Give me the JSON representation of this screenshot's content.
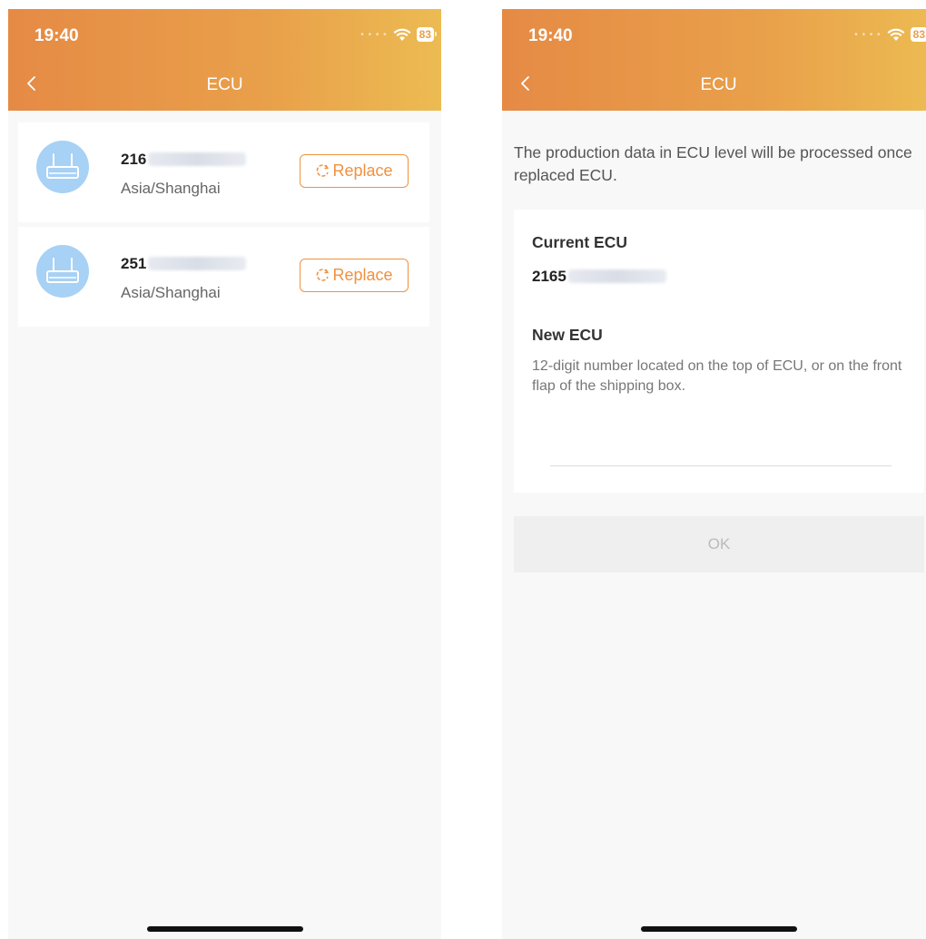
{
  "status_bar": {
    "time": "19:40",
    "battery": "83"
  },
  "left_screen": {
    "title": "ECU",
    "ecus": [
      {
        "id_prefix": "216",
        "timezone": "Asia/Shanghai",
        "replace_label": "Replace"
      },
      {
        "id_prefix": "251",
        "timezone": "Asia/Shanghai",
        "replace_label": "Replace"
      }
    ]
  },
  "right_screen": {
    "title": "ECU",
    "info": "The production data in ECU level will be processed once replaced ECU.",
    "current_label": "Current ECU",
    "current_value": "2165",
    "new_label": "New ECU",
    "hint": "12-digit number located on the top of ECU, or on the front flap of the shipping box.",
    "new_value": "",
    "ok_label": "OK"
  },
  "colors": {
    "accent": "#f0913f",
    "header_start": "#e58a45",
    "header_end": "#ecbb52",
    "avatar_bg": "#a7d1f5"
  },
  "icons": {
    "back": "chevron-left-icon",
    "avatar": "router-icon",
    "replace": "refresh-icon",
    "wifi": "wifi-icon",
    "battery": "battery-icon"
  }
}
